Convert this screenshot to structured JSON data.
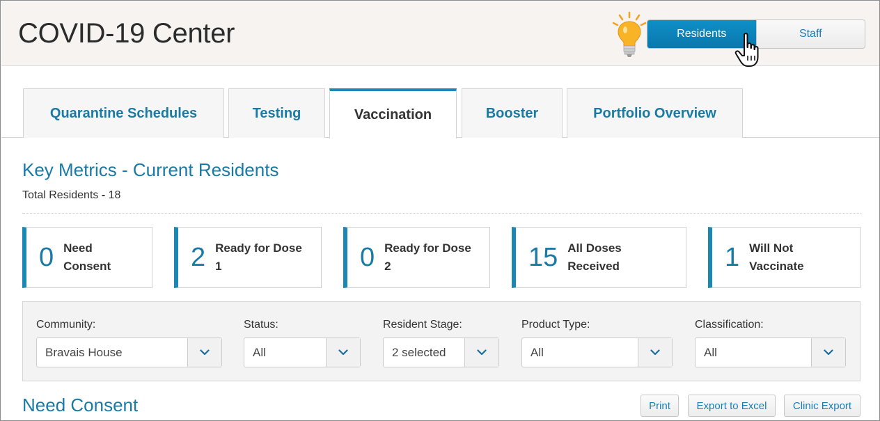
{
  "header": {
    "title": "COVID-19 Center",
    "toggle": {
      "residents_label": "Residents",
      "staff_label": "Staff",
      "active": "Residents"
    },
    "icons": [
      "lightbulb-icon",
      "hand-pointer-cursor-icon"
    ]
  },
  "tabs": [
    {
      "label": "Quarantine Schedules",
      "active": false
    },
    {
      "label": "Testing",
      "active": false
    },
    {
      "label": "Vaccination",
      "active": true
    },
    {
      "label": "Booster",
      "active": false
    },
    {
      "label": "Portfolio Overview",
      "active": false
    }
  ],
  "metrics_section": {
    "title": "Key Metrics - Current Residents",
    "total_label": "Total Residents",
    "total_separator": "-",
    "total_value": "18"
  },
  "metrics": [
    {
      "value": "0",
      "label_line1": "Need",
      "label_line2": "Consent"
    },
    {
      "value": "2",
      "label_line1": "Ready for Dose",
      "label_line2": "1"
    },
    {
      "value": "0",
      "label_line1": "Ready for Dose",
      "label_line2": "2"
    },
    {
      "value": "15",
      "label_line1": "All Doses",
      "label_line2": "Received"
    },
    {
      "value": "1",
      "label_line1": "Will Not",
      "label_line2": "Vaccinate"
    }
  ],
  "filters": [
    {
      "label": "Community:",
      "value": "Bravais House"
    },
    {
      "label": "Status:",
      "value": "All"
    },
    {
      "label": "Resident Stage:",
      "value": "2 selected"
    },
    {
      "label": "Product Type:",
      "value": "All"
    },
    {
      "label": "Classification:",
      "value": "All"
    }
  ],
  "need_consent": {
    "title": "Need Consent",
    "actions": {
      "print": "Print",
      "export_excel": "Export to Excel",
      "clinic_export": "Clinic Export"
    }
  },
  "colors": {
    "accent": "#1a87b5",
    "link": "#1a7aa6",
    "toggle_active": "#0e8fc7",
    "header_bg": "#f7f3f1",
    "bulb": "#f7a21b"
  }
}
